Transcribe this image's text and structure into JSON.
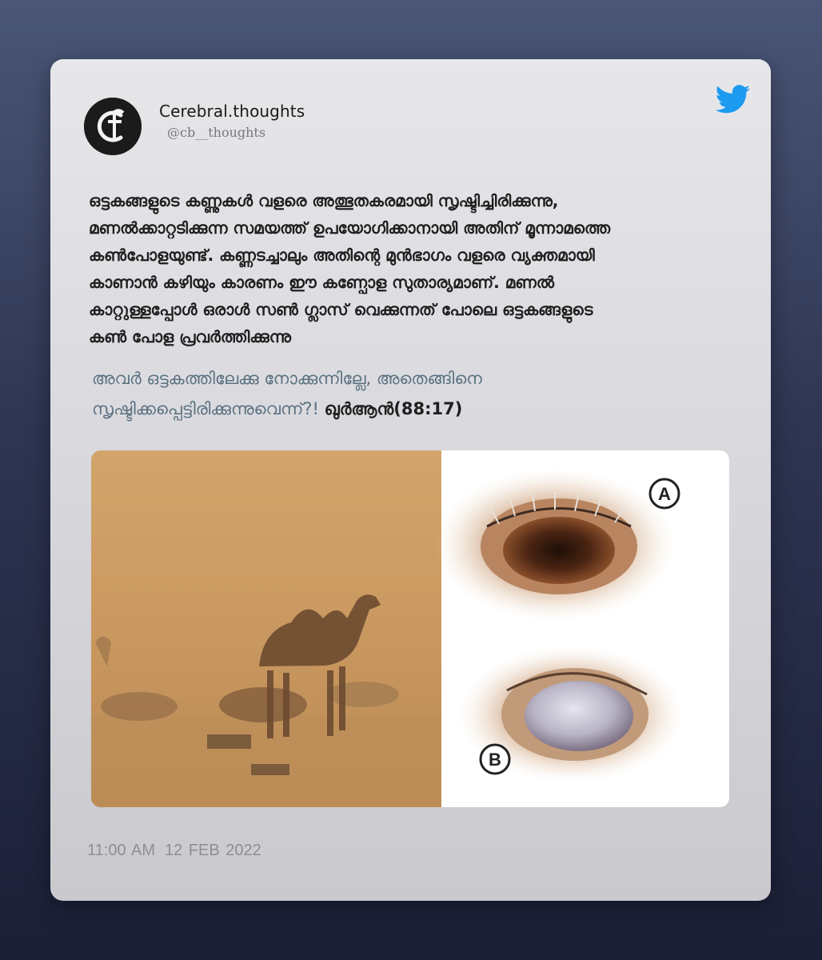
{
  "tweet": {
    "display_name": "Cerebral.thoughts",
    "handle": "@cb__thoughts",
    "avatar_icon": "cb-logo-icon",
    "platform_icon": "twitter-bird-icon",
    "accent_color": "#1d9bf0",
    "body_lines": [
      "ഒട്ടകങ്ങളുടെ കണ്ണുകൾ വളരെ അത്ഭുതകരമായി സൃഷ്ടിച്ചിരിക്കുന്നു,",
      "മണൽക്കാറ്റടിക്കുന്ന സമയത്ത് ഉപയോഗിക്കാനായി അതിന് മൂന്നാമത്തെ",
      "കൺപോളയുണ്ട്. കണ്ണടച്ചാലും അതിന്റെ മുൻഭാഗം വളരെ വ്യക്തമായി",
      "കാണാൻ കഴിയും കാരണം ഈ കണ്പോള സുതാര്യമാണ്. മണൽ",
      "കാറ്റുള്ളപ്പോൾ ഒരാൾ സൺ ഗ്ലാസ് വെക്കുന്നത് പോലെ ഒട്ടകങ്ങളുടെ",
      "കൺ പോള പ്രവർത്തിക്കുന്നു"
    ],
    "quote_line1": "അവർ ഒട്ടകത്തിലേക്കു നോക്കുന്നില്ലേ, അതെങ്ങിനെ",
    "quote_line2": "സൃഷ്ടിക്കപ്പെട്ടിരിക്കുന്നുവെന്ന്?!",
    "quote_reference": "ഖുർആൻ(88:17)",
    "media": {
      "left_image": "camels-in-sandstorm-photo",
      "right_image": "camel-eye-diagram",
      "label_a": "A",
      "label_b": "B"
    },
    "time": "11:00 AM",
    "date": "12 FEB 2022"
  }
}
